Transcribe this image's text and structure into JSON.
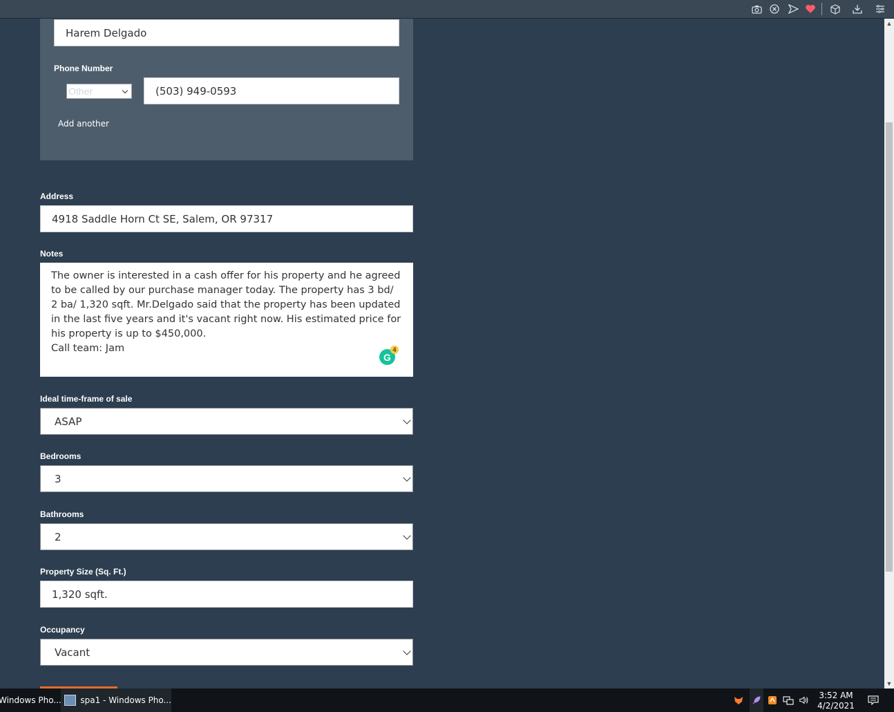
{
  "contact": {
    "name_value": "Harem Delgado",
    "phone_label": "Phone Number",
    "phone_type": "Other",
    "phone_value": "(503) 949-0593",
    "add_another": "Add another"
  },
  "form": {
    "address_label": "Address",
    "address_value": "4918 Saddle Horn Ct SE, Salem, OR 97317",
    "notes_label": "Notes",
    "notes_line1": "The owner is interested in a cash offer for his property and he agreed to be called by our purchase manager today. The property has 3 bd/ 2 ba/ 1,320 sqft. Mr.Delgado said that the property has been updated in the last five years and it's vacant right now. His estimated price for his property is up to $450,000.",
    "notes_line2": "Call team: Jam",
    "grammarly_count": "4",
    "timeframe_label": "Ideal time-frame of sale",
    "timeframe_value": "ASAP",
    "bedrooms_label": "Bedrooms",
    "bedrooms_value": "3",
    "bathrooms_label": "Bathrooms",
    "bathrooms_value": "2",
    "size_label": "Property Size (Sq. Ft.)",
    "size_value": "1,320 sqft.",
    "occupancy_label": "Occupancy",
    "occupancy_value": "Vacant"
  },
  "taskbar": {
    "app1": "Windows Pho...",
    "app2": "spa1 - Windows Pho...",
    "time": "3:52 AM",
    "date": "4/2/2021"
  },
  "colors": {
    "page_bg": "#2d3e50",
    "panel_bg": "#4e5d6c",
    "accent": "#e86a2f",
    "grammarly": "#15c39a"
  },
  "icons": {
    "toolbar": [
      "camera-icon",
      "close-circle-icon",
      "send-icon",
      "heart-icon",
      "cube-icon",
      "download-icon",
      "menu-icon"
    ]
  }
}
